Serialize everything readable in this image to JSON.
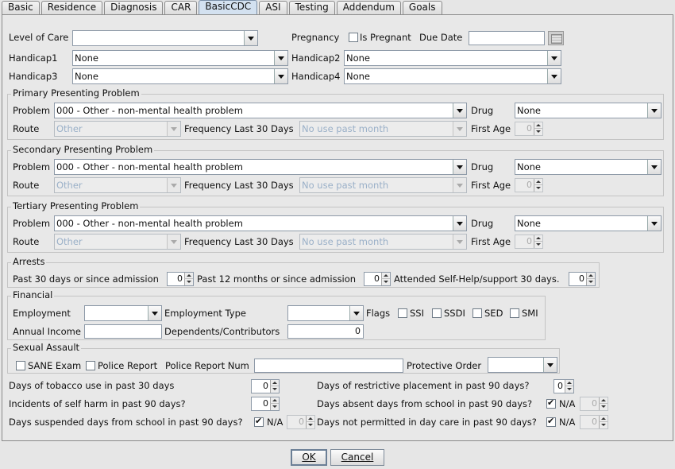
{
  "tabs": [
    {
      "label": "Basic"
    },
    {
      "label": "Residence"
    },
    {
      "label": "Diagnosis"
    },
    {
      "label": "CAR"
    },
    {
      "label": "BasicCDC",
      "active": true
    },
    {
      "label": "ASI"
    },
    {
      "label": "Testing"
    },
    {
      "label": "Addendum"
    },
    {
      "label": "Goals"
    }
  ],
  "top": {
    "level_of_care_label": "Level of Care",
    "level_of_care_value": "",
    "pregnancy_label": "Pregnancy",
    "is_pregnant_label": "Is Pregnant",
    "is_pregnant_checked": false,
    "due_date_label": "Due Date",
    "due_date_value": "",
    "handicap1_label": "Handicap1",
    "handicap1_value": "None",
    "handicap2_label": "Handicap2",
    "handicap2_value": "None",
    "handicap3_label": "Handicap3",
    "handicap3_value": "None",
    "handicap4_label": "Handicap4",
    "handicap4_value": "None"
  },
  "primary": {
    "title": "Primary Presenting Problem",
    "problem_label": "Problem",
    "problem_value": "000 - Other - non-mental health problem",
    "drug_label": "Drug",
    "drug_value": "None",
    "route_label": "Route",
    "route_value": "Other",
    "freq_label": "Frequency Last 30 Days",
    "freq_value": "No use past month",
    "first_age_label": "First Age",
    "first_age_value": "0"
  },
  "secondary": {
    "title": "Secondary Presenting Problem",
    "problem_label": "Problem",
    "problem_value": "000 - Other - non-mental health problem",
    "drug_label": "Drug",
    "drug_value": "None",
    "route_label": "Route",
    "route_value": "Other",
    "freq_label": "Frequency Last 30 Days",
    "freq_value": "No use past month",
    "first_age_label": "First Age",
    "first_age_value": "0"
  },
  "tertiary": {
    "title": "Tertiary Presenting Problem",
    "problem_label": "Problem",
    "problem_value": "000 - Other - non-mental health problem",
    "drug_label": "Drug",
    "drug_value": "None",
    "route_label": "Route",
    "route_value": "Other",
    "freq_label": "Frequency Last 30 Days",
    "freq_value": "No use past month",
    "first_age_label": "First Age",
    "first_age_value": "0"
  },
  "arrests": {
    "title": "Arrests",
    "past30_label": "Past 30 days or since admission",
    "past30_value": "0",
    "past12_label": "Past 12 months or since admission",
    "past12_value": "0",
    "selfhelp_label": "Attended Self-Help/support 30 days.",
    "selfhelp_value": "0"
  },
  "financial": {
    "title": "Financial",
    "employment_label": "Employment",
    "employment_value": "",
    "employment_type_label": "Employment Type",
    "employment_type_value": "",
    "flags_label": "Flags",
    "ssi_label": "SSI",
    "ssdi_label": "SSDI",
    "sed_label": "SED",
    "smi_label": "SMI",
    "annual_income_label": "Annual Income",
    "annual_income_value": "",
    "dependents_label": "Dependents/Contributors",
    "dependents_value": "0"
  },
  "assault": {
    "title": "Sexual Assault",
    "sane_label": "SANE Exam",
    "police_report_label": "Police Report",
    "police_report_num_label": "Police Report Num",
    "police_report_num_value": "",
    "protective_order_label": "Protective Order",
    "protective_order_value": ""
  },
  "bottom": {
    "tobacco_label": "Days of tobacco use in past 30 days",
    "tobacco_value": "0",
    "restrictive_label": "Days of restrictive placement in past 90 days?",
    "restrictive_value": "0",
    "selfharm_label": "Incidents of self harm in past 90 days?",
    "selfharm_value": "0",
    "absent_label": "Days absent days from school in past 90 days?",
    "absent_na_label": "N/A",
    "absent_value": "0",
    "suspended_label": "Days suspended days from school in past 90 days?",
    "suspended_na_label": "N/A",
    "suspended_value": "0",
    "daycare_label": "Days not permitted in day care in past 90 days?",
    "daycare_na_label": "N/A",
    "daycare_value": "0"
  },
  "buttons": {
    "ok_label": "OK",
    "cancel_label": "Cancel"
  }
}
